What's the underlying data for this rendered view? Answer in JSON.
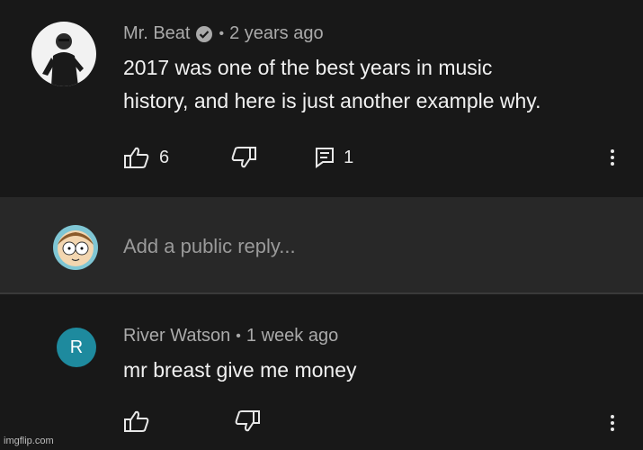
{
  "comment": {
    "author": "Mr. Beat",
    "time": "2 years ago",
    "line1": "2017 was one of the best years in music",
    "line2": "history, and here is just another example why.",
    "likes": "6",
    "replies": "1"
  },
  "reply_box": {
    "placeholder": "Add a public reply..."
  },
  "reply": {
    "avatar_letter": "R",
    "author": "River Watson",
    "time": "1 week ago",
    "text": "mr breast give me  money"
  },
  "watermark": "imgflip.com",
  "colors": {
    "background": "#181818",
    "reply_box_bg": "#282828",
    "avatar_teal": "#1e8a9e"
  }
}
